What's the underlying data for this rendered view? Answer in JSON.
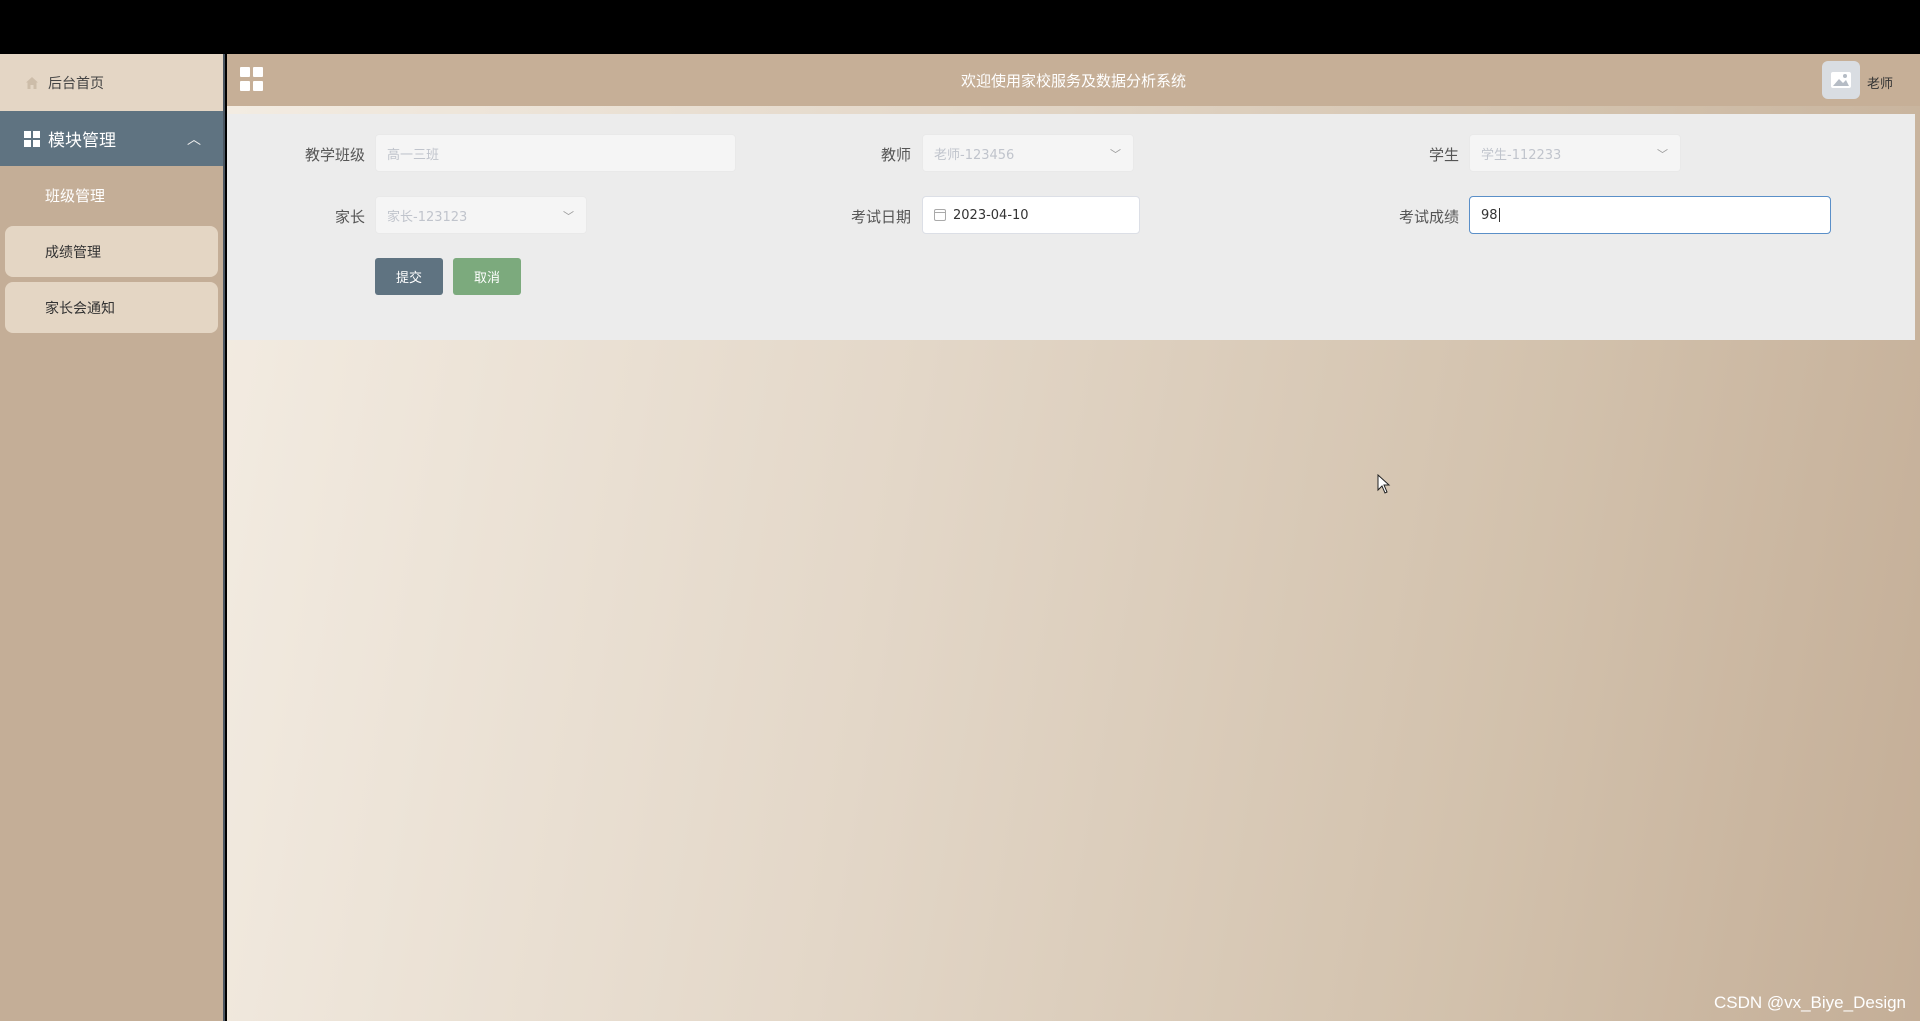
{
  "header": {
    "title": "欢迎使用家校服务及数据分析系统",
    "user_label": "老师"
  },
  "sidebar": {
    "home_label": "后台首页",
    "module_label": "模块管理",
    "items": [
      {
        "label": "班级管理",
        "active": true
      },
      {
        "label": "成绩管理",
        "active": false
      },
      {
        "label": "家长会通知",
        "active": false
      }
    ]
  },
  "form": {
    "class_label": "教学班级",
    "class_value": "高一三班",
    "teacher_label": "教师",
    "teacher_value": "老师-123456",
    "student_label": "学生",
    "student_value": "学生-112233",
    "parent_label": "家长",
    "parent_value": "家长-123123",
    "date_label": "考试日期",
    "date_value": "2023-04-10",
    "score_label": "考试成绩",
    "score_value": "98",
    "submit_label": "提交",
    "cancel_label": "取消"
  },
  "watermark": "CSDN @vx_Biye_Design",
  "colors": {
    "sidebar_bg": "#c4ae97",
    "module_bg": "#5f7381",
    "submit_bg": "#5f7381",
    "cancel_bg": "#7caa7d",
    "header_bg": "#c6af97"
  }
}
